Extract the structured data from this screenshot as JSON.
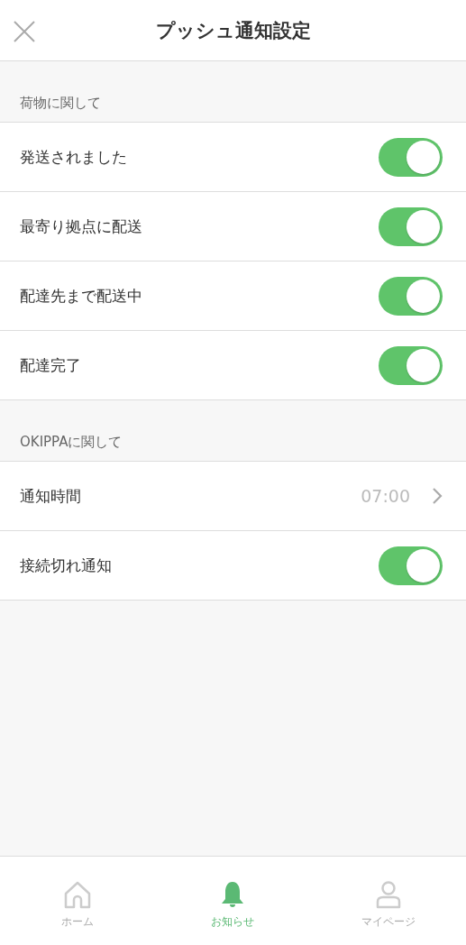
{
  "header": {
    "title": "プッシュ通知設定"
  },
  "sections": [
    {
      "title": "荷物に関して",
      "rows": [
        {
          "kind": "toggle",
          "label": "発送されました",
          "on": true
        },
        {
          "kind": "toggle",
          "label": "最寄り拠点に配送",
          "on": true
        },
        {
          "kind": "toggle",
          "label": "配達先まで配送中",
          "on": true
        },
        {
          "kind": "toggle",
          "label": "配達完了",
          "on": true
        }
      ]
    },
    {
      "title": "OKIPPAに関して",
      "rows": [
        {
          "kind": "link",
          "label": "通知時間",
          "value": "07:00"
        },
        {
          "kind": "toggle",
          "label": "接続切れ通知",
          "on": true
        }
      ]
    }
  ],
  "tabs": [
    {
      "kind": "home",
      "label": "ホーム",
      "selected": false
    },
    {
      "kind": "bell",
      "label": "お知らせ",
      "selected": true
    },
    {
      "kind": "person",
      "label": "マイページ",
      "selected": false
    }
  ]
}
